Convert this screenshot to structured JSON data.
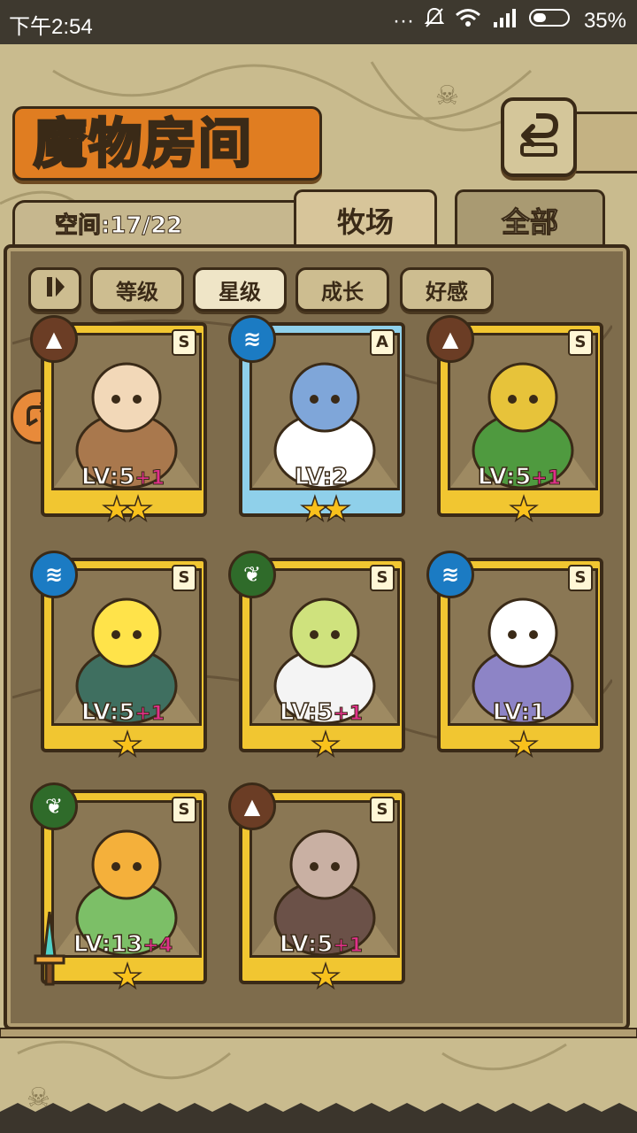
{
  "status_bar": {
    "time": "下午2:54",
    "battery": "35%"
  },
  "header": {
    "title": "魔物房间",
    "back_icon": "return-arrow-icon"
  },
  "space": {
    "label": "空间:17/22"
  },
  "tabs": [
    {
      "label": "牧场",
      "active": true
    },
    {
      "label": "全部",
      "active": false
    }
  ],
  "sort": {
    "toggle_icon": "pause-toggle-icon",
    "buttons": [
      {
        "label": "等级",
        "active": false
      },
      {
        "label": "星级",
        "active": true
      },
      {
        "label": "成长",
        "active": false
      },
      {
        "label": "好感",
        "active": false
      }
    ]
  },
  "monsters": [
    {
      "element": "earth",
      "element_icon": "mountain-icon",
      "rank": "S",
      "lv": "LV:5",
      "plus": "+1",
      "stars": "★★",
      "frame": "gold",
      "name_icon": "fox-girl-icon"
    },
    {
      "element": "water",
      "element_icon": "water-wave-icon",
      "rank": "A",
      "lv": "LV:2",
      "plus": "",
      "stars": "★★",
      "frame": "blue",
      "name_icon": "lily-girl-icon"
    },
    {
      "element": "earth",
      "element_icon": "mountain-icon",
      "rank": "S",
      "lv": "LV:5",
      "plus": "+1",
      "stars": "★",
      "frame": "gold",
      "name_icon": "mantis-girl-icon"
    },
    {
      "element": "water",
      "element_icon": "water-wave-icon",
      "rank": "S",
      "lv": "LV:5",
      "plus": "+1",
      "stars": "★",
      "frame": "gold",
      "name_icon": "seaweed-ghost-icon"
    },
    {
      "element": "plant",
      "element_icon": "leaf-icon",
      "rank": "S",
      "lv": "LV:5",
      "plus": "+1",
      "stars": "★",
      "frame": "gold",
      "name_icon": "flower-fairy-icon"
    },
    {
      "element": "water",
      "element_icon": "water-wave-icon",
      "rank": "S",
      "lv": "LV:1",
      "plus": "",
      "stars": "★",
      "frame": "gold",
      "name_icon": "harpy-girl-icon"
    },
    {
      "element": "plant",
      "element_icon": "leaf-icon",
      "rank": "S",
      "lv": "LV:13",
      "plus": "+4",
      "stars": "★",
      "frame": "gold",
      "name_icon": "slime-plant-icon"
    },
    {
      "element": "earth",
      "element_icon": "mountain-icon",
      "rank": "S",
      "lv": "LV:5",
      "plus": "+1",
      "stars": "★",
      "frame": "gold",
      "name_icon": "mimic-girl-icon"
    }
  ],
  "colors": {
    "frame_gold": "#f1c631",
    "frame_blue": "#8fd0ea",
    "accent_orange": "#e07d21",
    "plus_pink": "#e0308a"
  }
}
